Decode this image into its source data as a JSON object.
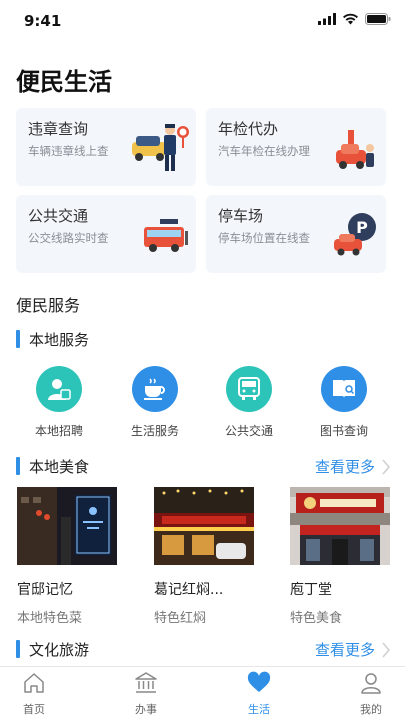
{
  "status_bar": {
    "time": "9:41"
  },
  "page_title": "便民生活",
  "cards": [
    {
      "title": "违章查询",
      "subtitle": "车辆违章线上查",
      "icon": "traffic-police-icon"
    },
    {
      "title": "年检代办",
      "subtitle": "汽车年检在线办理",
      "icon": "car-inspection-icon"
    },
    {
      "title": "公共交通",
      "subtitle": "公交线路实时查",
      "icon": "bus-icon"
    },
    {
      "title": "停车场",
      "subtitle": "停车场位置在线查",
      "icon": "parking-icon"
    }
  ],
  "section_title": "便民服务",
  "local_services": {
    "heading": "本地服务",
    "items": [
      {
        "label": "本地招聘",
        "icon": "recruit-icon",
        "color": "#2cc3b8"
      },
      {
        "label": "生活服务",
        "icon": "coffee-cup-icon",
        "color": "#2f8fe6"
      },
      {
        "label": "公共交通",
        "icon": "bus-icon",
        "color": "#2cc3b8"
      },
      {
        "label": "图书查询",
        "icon": "book-search-icon",
        "color": "#2f8fe6"
      }
    ]
  },
  "local_food": {
    "heading": "本地美食",
    "more": "查看更多",
    "items": [
      {
        "name": "官邸记忆",
        "subtitle": "本地特色菜"
      },
      {
        "name": "葛记红焖...",
        "subtitle": "特色红焖"
      },
      {
        "name": "庖丁堂",
        "subtitle": "特色美食"
      }
    ]
  },
  "culture": {
    "heading": "文化旅游",
    "more": "查看更多"
  },
  "tabs": [
    {
      "label": "首页",
      "icon": "home-icon",
      "active": false
    },
    {
      "label": "办事",
      "icon": "government-icon",
      "active": false
    },
    {
      "label": "生活",
      "icon": "heart-icon",
      "active": true
    },
    {
      "label": "我的",
      "icon": "user-icon",
      "active": false
    }
  ],
  "colors": {
    "accent": "#2f8fe6",
    "teal": "#2cc3b8",
    "card_bg": "#f3f6fb"
  }
}
